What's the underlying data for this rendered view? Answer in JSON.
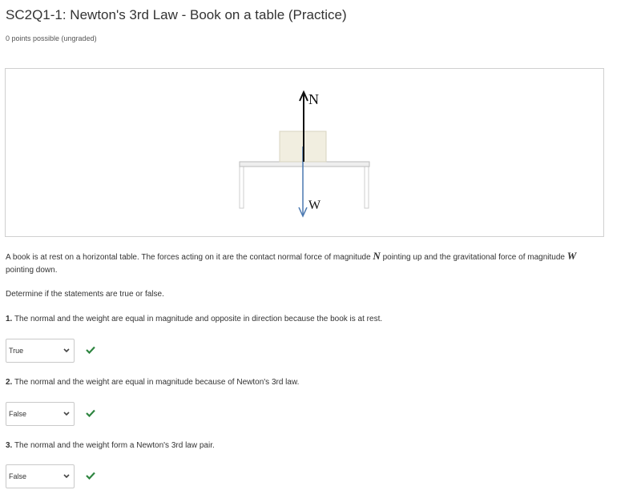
{
  "header": {
    "title": "SC2Q1-1: Newton's 3rd Law - Book on a table (Practice)",
    "points": "0 points possible (ungraded)"
  },
  "figure": {
    "normal_label": "N",
    "weight_label": "W"
  },
  "problem": {
    "intro_part1": "A book is at rest on a horizontal table. The forces acting on it are the contact normal force of magnitude ",
    "var_n": "N",
    "intro_part2": " pointing up and the gravitational force of magnitude ",
    "var_w": "W",
    "intro_part3": "pointing down.",
    "instruction": "Determine if the statements are true or false."
  },
  "questions": [
    {
      "number": "1.",
      "text": " The normal and the weight are equal in magnitude and opposite in direction because the book is at rest.",
      "answer": "True",
      "correct": true
    },
    {
      "number": "2.",
      "text": " The normal and the weight are equal in magnitude because of Newton's 3rd law.",
      "answer": "False",
      "correct": true
    },
    {
      "number": "3.",
      "text": " The normal and the weight form a Newton's 3rd law pair.",
      "answer": "False",
      "correct": true
    }
  ],
  "colors": {
    "check": "#2e8540",
    "weight_arrow": "#4a78b0",
    "book": "#f1eee0"
  },
  "icons": {
    "select_arrow": "chevron-down-icon",
    "correct_mark": "checkmark-icon"
  }
}
